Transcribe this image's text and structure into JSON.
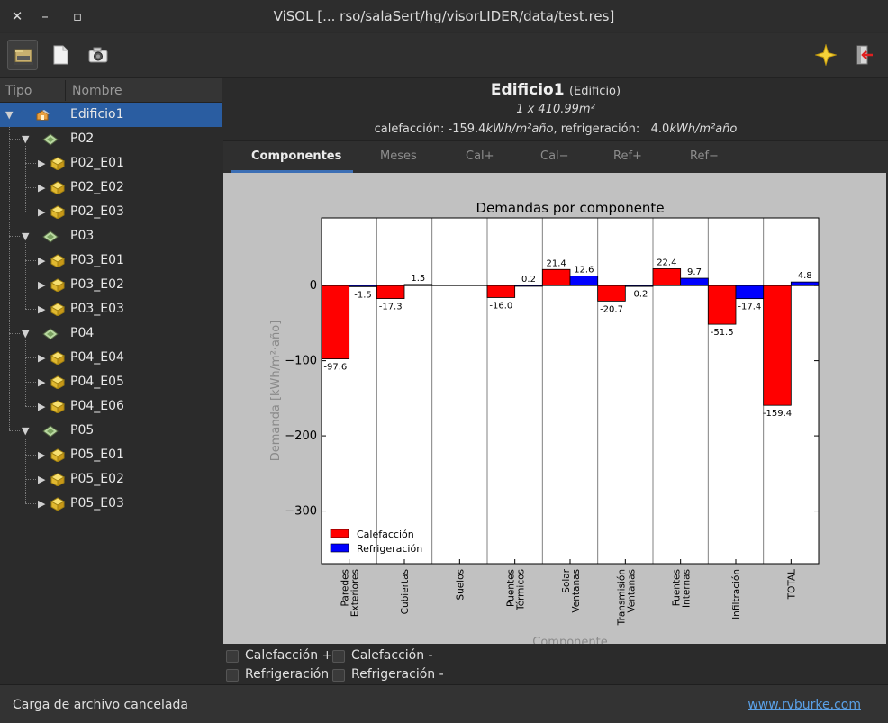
{
  "window": {
    "title": "ViSOL [... rso/salaSert/hg/visorLIDER/data/test.res]",
    "close_glyph": "✕",
    "minimize_glyph": "–",
    "maximize_glyph": "▫"
  },
  "toolbar": {
    "left_buttons": [
      "open-file-icon",
      "new-document-icon",
      "camera-icon"
    ],
    "right_buttons": [
      "sparkle-icon",
      "exit-icon"
    ]
  },
  "sidebar": {
    "col_tipo": "Tipo",
    "col_nombre": "Nombre",
    "root": "Edificio1",
    "floors": [
      {
        "label": "P02",
        "spaces": [
          "P02_E01",
          "P02_E02",
          "P02_E03"
        ]
      },
      {
        "label": "P03",
        "spaces": [
          "P03_E01",
          "P03_E02",
          "P03_E03"
        ]
      },
      {
        "label": "P04",
        "spaces": [
          "P04_E04",
          "P04_E05",
          "P04_E06"
        ]
      },
      {
        "label": "P05",
        "spaces": [
          "P05_E01",
          "P05_E02",
          "P05_E03"
        ]
      }
    ]
  },
  "header": {
    "name": "Edificio1",
    "type": "(Edificio)",
    "area": "1 x 410.99m²",
    "heating_label": "calefacción:",
    "heating_value": "-159.4",
    "heating_unit": "kWh/m²año",
    "cooling_label": ", refrigeración:",
    "cooling_value": "4.0",
    "cooling_unit": "kWh/m²año"
  },
  "tabs": [
    "Componentes",
    "Meses",
    "Cal+",
    "Cal−",
    "Ref+",
    "Ref−"
  ],
  "active_tab": 0,
  "chart_data": {
    "type": "bar",
    "title": "Demandas por componente",
    "xlabel": "Componente",
    "ylabel": "Demanda [kWh/m²·año]",
    "ylim": [
      -370,
      90
    ],
    "yticks": [
      0,
      -100,
      -200,
      -300
    ],
    "ytick_labels": [
      "0",
      "−100",
      "−200",
      "−300"
    ],
    "grid": false,
    "legend_position": "bottom-left",
    "categories": [
      "Paredes\nExteriores",
      "Cubiertas",
      "Suelos",
      "Puentes\nTérmicos",
      "Solar\nVentanas",
      "Transmisión\nVentanas",
      "Fuentes\nInternas",
      "Infiltración",
      "TOTAL"
    ],
    "series": [
      {
        "name": "Calefacción",
        "color": "#ff0000",
        "values": [
          -97.6,
          -17.3,
          0,
          -16.0,
          21.4,
          -20.7,
          22.4,
          -51.5,
          -159.4
        ],
        "labels": [
          "-97.6",
          "-17.3",
          "",
          "-16.0",
          "21.4",
          "-20.7",
          "22.4",
          "-51.5",
          "-159.4"
        ]
      },
      {
        "name": "Refrigeración",
        "color": "#0000ff",
        "values": [
          -1.5,
          1.5,
          0,
          0.2,
          12.6,
          -0.2,
          9.7,
          -17.4,
          4.8
        ],
        "labels": [
          "-1.5",
          "1.5",
          "",
          "0.2",
          "12.6",
          "-0.2",
          "9.7",
          "-17.4",
          "4.8"
        ]
      }
    ]
  },
  "checkboxes": {
    "cal_plus": "Calefacción +",
    "cal_minus": "Calefacción -",
    "ref_plus": "Refrigeración +",
    "ref_minus": "Refrigeración -"
  },
  "status": {
    "message": "Carga de archivo cancelada",
    "link": "www.rvburke.com"
  }
}
